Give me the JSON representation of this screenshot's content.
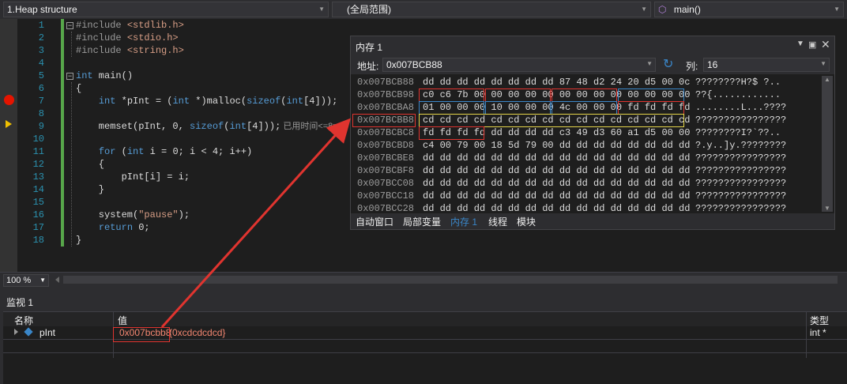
{
  "topbar": {
    "project": "1.Heap structure",
    "scope": "(全局范围)",
    "function": "main()"
  },
  "editor": {
    "line_numbers": [
      "1",
      "2",
      "3",
      "4",
      "5",
      "6",
      "7",
      "8",
      "9",
      "10",
      "11",
      "12",
      "13",
      "14",
      "15",
      "16",
      "17",
      "18"
    ],
    "lines": [
      {
        "segments": [
          {
            "t": "#include ",
            "c": "pp"
          },
          {
            "t": "<stdlib.h>",
            "c": "str"
          }
        ]
      },
      {
        "segments": [
          {
            "t": "#include ",
            "c": "pp"
          },
          {
            "t": "<stdio.h>",
            "c": "str"
          }
        ]
      },
      {
        "segments": [
          {
            "t": "#include ",
            "c": "pp"
          },
          {
            "t": "<string.h>",
            "c": "str"
          }
        ]
      },
      {
        "segments": []
      },
      {
        "segments": [
          {
            "t": "int",
            "c": "kw"
          },
          {
            "t": " main()",
            "c": ""
          }
        ]
      },
      {
        "segments": [
          {
            "t": "{",
            "c": ""
          }
        ]
      },
      {
        "segments": [
          {
            "t": "    ",
            "c": ""
          },
          {
            "t": "int",
            "c": "kw"
          },
          {
            "t": " *pInt = (",
            "c": ""
          },
          {
            "t": "int",
            "c": "kw"
          },
          {
            "t": " *)malloc(",
            "c": ""
          },
          {
            "t": "sizeof",
            "c": "kw"
          },
          {
            "t": "(",
            "c": ""
          },
          {
            "t": "int",
            "c": "kw"
          },
          {
            "t": "[4]));",
            "c": ""
          }
        ]
      },
      {
        "segments": []
      },
      {
        "segments": [
          {
            "t": "    memset(pInt, 0, ",
            "c": ""
          },
          {
            "t": "sizeof",
            "c": "kw"
          },
          {
            "t": "(",
            "c": ""
          },
          {
            "t": "int",
            "c": "kw"
          },
          {
            "t": "[4]));",
            "c": ""
          },
          {
            "t": " 已用时间<=8ms",
            "c": "hint"
          }
        ]
      },
      {
        "segments": []
      },
      {
        "segments": [
          {
            "t": "    ",
            "c": ""
          },
          {
            "t": "for",
            "c": "kw"
          },
          {
            "t": " (",
            "c": ""
          },
          {
            "t": "int",
            "c": "kw"
          },
          {
            "t": " i = 0; i < 4; i++)",
            "c": ""
          }
        ]
      },
      {
        "segments": [
          {
            "t": "    {",
            "c": ""
          }
        ]
      },
      {
        "segments": [
          {
            "t": "        pInt[i] = i;",
            "c": ""
          }
        ]
      },
      {
        "segments": [
          {
            "t": "    }",
            "c": ""
          }
        ]
      },
      {
        "segments": []
      },
      {
        "segments": [
          {
            "t": "    system(",
            "c": ""
          },
          {
            "t": "\"pause\"",
            "c": "str"
          },
          {
            "t": ");",
            "c": ""
          }
        ]
      },
      {
        "segments": [
          {
            "t": "    ",
            "c": ""
          },
          {
            "t": "return",
            "c": "kw"
          },
          {
            "t": " 0;",
            "c": ""
          }
        ]
      },
      {
        "segments": [
          {
            "t": "}",
            "c": ""
          }
        ]
      }
    ]
  },
  "zoom": {
    "level": "100 %"
  },
  "memory": {
    "title": "内存 1",
    "address_label": "地址:",
    "address_value": "0x007BCB88",
    "columns_label": "列:",
    "columns_value": "16",
    "rows": [
      {
        "addr": "0x007BCB88",
        "bytes": "dd dd dd dd dd dd dd dd 87 48 d2 24 20 d5 00 0c",
        "chars": "????????H?$ ?.."
      },
      {
        "addr": "0x007BCB98",
        "bytes": "c0 c6 7b 00 00 00 00 00 00 00 00 00 00 00 00 00",
        "chars": "??{............"
      },
      {
        "addr": "0x007BCBA8",
        "bytes": "01 00 00 00 10 00 00 00 4c 00 00 00 fd fd fd fd",
        "chars": "........L...????"
      },
      {
        "addr": "0x007BCBB8",
        "bytes": "cd cd cd cd cd cd cd cd cd cd cd cd cd cd cd cd",
        "chars": "????????????????"
      },
      {
        "addr": "0x007BCBC8",
        "bytes": "fd fd fd fd dd dd dd dd c3 49 d3 60 a1 d5 00 00",
        "chars": "????????I?`??.."
      },
      {
        "addr": "0x007BCBD8",
        "bytes": "c4 00 79 00 18 5d 79 00 dd dd dd dd dd dd dd dd",
        "chars": "?.y..]y.????????"
      },
      {
        "addr": "0x007BCBE8",
        "bytes": "dd dd dd dd dd dd dd dd dd dd dd dd dd dd dd dd",
        "chars": "????????????????"
      },
      {
        "addr": "0x007BCBF8",
        "bytes": "dd dd dd dd dd dd dd dd dd dd dd dd dd dd dd dd",
        "chars": "????????????????"
      },
      {
        "addr": "0x007BCC08",
        "bytes": "dd dd dd dd dd dd dd dd dd dd dd dd dd dd dd dd",
        "chars": "????????????????"
      },
      {
        "addr": "0x007BCC18",
        "bytes": "dd dd dd dd dd dd dd dd dd dd dd dd dd dd dd dd",
        "chars": "????????????????"
      },
      {
        "addr": "0x007BCC28",
        "bytes": "dd dd dd dd dd dd dd dd dd dd dd dd dd dd dd dd",
        "chars": "????????????????"
      }
    ],
    "tabs": [
      "自动窗口",
      "局部变量",
      "内存 1",
      "线程",
      "模块"
    ],
    "active_tab": 2
  },
  "watch": {
    "title": "监视 1",
    "col_name": "名称",
    "col_value": "值",
    "col_type": "类型",
    "row": {
      "name": "pInt",
      "value_addr": "0x007bcbb8",
      "value_rest": "{0xcdcdcdcd}",
      "type": "int *"
    }
  },
  "colors": {
    "annotation_red": "#e0342f",
    "annotation_yellow": "#e6d64a",
    "annotation_blue": "#3a86c8",
    "breakpoint": "#e51400",
    "current_line_arrow": "#f0c000"
  }
}
